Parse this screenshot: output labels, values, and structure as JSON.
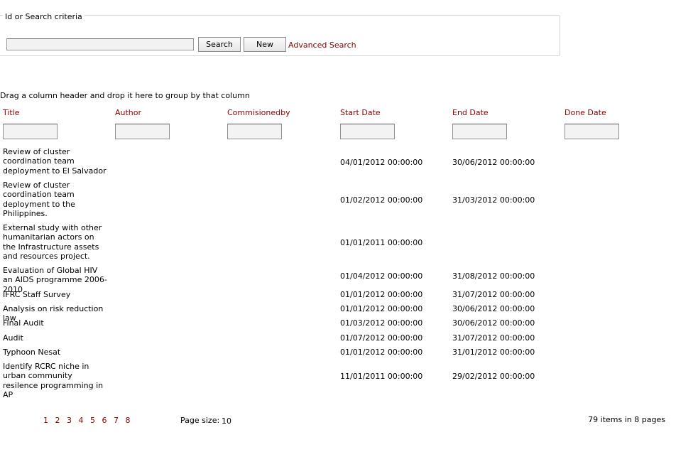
{
  "search": {
    "legend": "Id or Search criteria",
    "input_value": "",
    "search_label": "Search",
    "new_label": "New",
    "advanced_label": "Advanced Search"
  },
  "grid": {
    "group_hint": "Drag a column header and drop it here to group by that column",
    "columns": [
      "Title",
      "Author",
      "Commisionedby",
      "Start Date",
      "End Date",
      "Done Date"
    ],
    "rows": [
      {
        "title": "Review of cluster coordination team deployment to El Salvador",
        "author": "",
        "commissionedby": "",
        "start": "04/01/2012 00:00:00",
        "end": "30/06/2012 00:00:00",
        "done": ""
      },
      {
        "title": "Review of cluster coordination team deployment to the Philippines.",
        "author": "",
        "commissionedby": "",
        "start": "01/02/2012 00:00:00",
        "end": "31/03/2012 00:00:00",
        "done": ""
      },
      {
        "title": "External study with other humanitarian actors on the Infrastructure assets and resources project.",
        "author": "",
        "commissionedby": "",
        "start": "01/01/2011 00:00:00",
        "end": "",
        "done": ""
      },
      {
        "title": "Evaluation of Global HIV an AIDS programme 2006-2010",
        "author": "",
        "commissionedby": "",
        "start": "01/04/2012 00:00:00",
        "end": "31/08/2012 00:00:00",
        "done": ""
      },
      {
        "title": "IFRC Staff Survey",
        "author": "",
        "commissionedby": "",
        "start": "01/01/2012 00:00:00",
        "end": "31/07/2012 00:00:00",
        "done": ""
      },
      {
        "title": "Analysis on risk reduction law",
        "author": "",
        "commissionedby": "",
        "start": "01/01/2012 00:00:00",
        "end": "30/06/2012 00:00:00",
        "done": ""
      },
      {
        "title": "Final Audit",
        "author": "",
        "commissionedby": "",
        "start": "01/03/2012 00:00:00",
        "end": "30/06/2012 00:00:00",
        "done": ""
      },
      {
        "title": "Audit",
        "author": "",
        "commissionedby": "",
        "start": "01/07/2012 00:00:00",
        "end": "31/07/2012 00:00:00",
        "done": ""
      },
      {
        "title": "Typhoon Nesat",
        "author": "",
        "commissionedby": "",
        "start": "01/01/2012 00:00:00",
        "end": "31/01/2012 00:00:00",
        "done": ""
      },
      {
        "title": "Identify RCRC niche in urban community resilence programming in AP",
        "author": "",
        "commissionedby": "",
        "start": "11/01/2011 00:00:00",
        "end": "29/02/2012 00:00:00",
        "done": ""
      }
    ]
  },
  "pager": {
    "pages": [
      "1",
      "2",
      "3",
      "4",
      "5",
      "6",
      "7",
      "8"
    ],
    "page_size_label": "Page size:",
    "page_size_value": "10",
    "summary_count": "79",
    "summary_items_in": "items in",
    "summary_pages": "8",
    "summary_pages_label": "pages"
  },
  "colors": {
    "link": "#8b0000",
    "border": "#d3d3d3"
  }
}
